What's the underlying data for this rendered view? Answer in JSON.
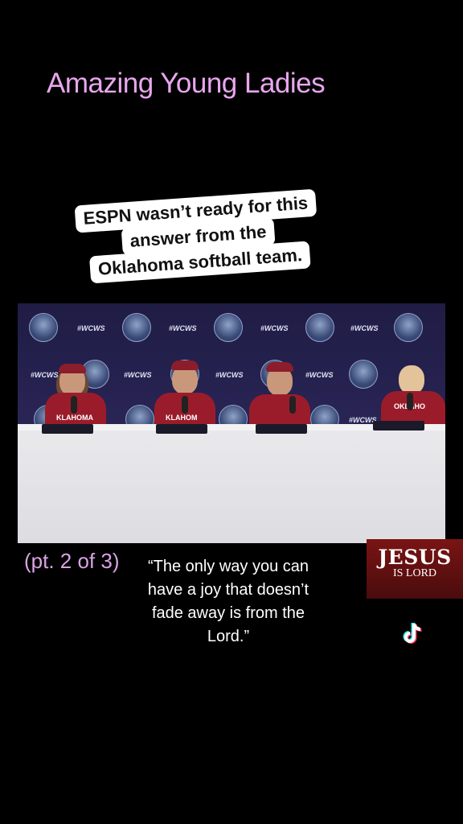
{
  "overlay_title": "Amazing Young Ladies",
  "caption": {
    "line1": "ESPN wasn’t ready for this",
    "line2": "answer from the",
    "line3": "Oklahoma softball team."
  },
  "video": {
    "backdrop_hashtag": "#WCWS",
    "jerseys": [
      "KLAHOMA",
      "KLAHOM",
      "",
      "OKLAHO"
    ]
  },
  "part_label": "(pt. 2 of 3)",
  "quote": {
    "line1": "“The only way you can",
    "line2": "have a joy that doesn’t",
    "line3": "fade away is from the",
    "line4": "Lord.”"
  },
  "badge": {
    "big": "JESUS",
    "small": "IS LORD"
  },
  "icons": {
    "tiktok": "tiktok-logo-icon"
  },
  "colors": {
    "title": "#e8a6ee",
    "part_label": "#d9a2e6",
    "badge_bg": "#7a1414",
    "jersey": "#9a1c2b"
  }
}
